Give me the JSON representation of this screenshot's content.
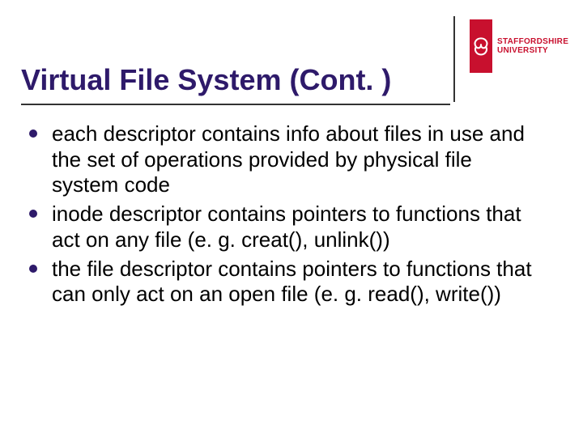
{
  "brand": {
    "name_line1": "STAFFORDSHIRE",
    "name_line2": "UNIVERSITY",
    "accent": "#c8102e",
    "heading_color": "#2e1a6a"
  },
  "slide": {
    "title": "Virtual File System (Cont. )",
    "bullets": [
      "each descriptor contains info about files in use and the set of operations provided by physical file system code",
      "inode descriptor contains pointers to functions that act on any file (e. g. creat(), unlink())",
      "the file descriptor contains pointers to functions that can only act on an open file (e. g. read(), write())"
    ]
  }
}
